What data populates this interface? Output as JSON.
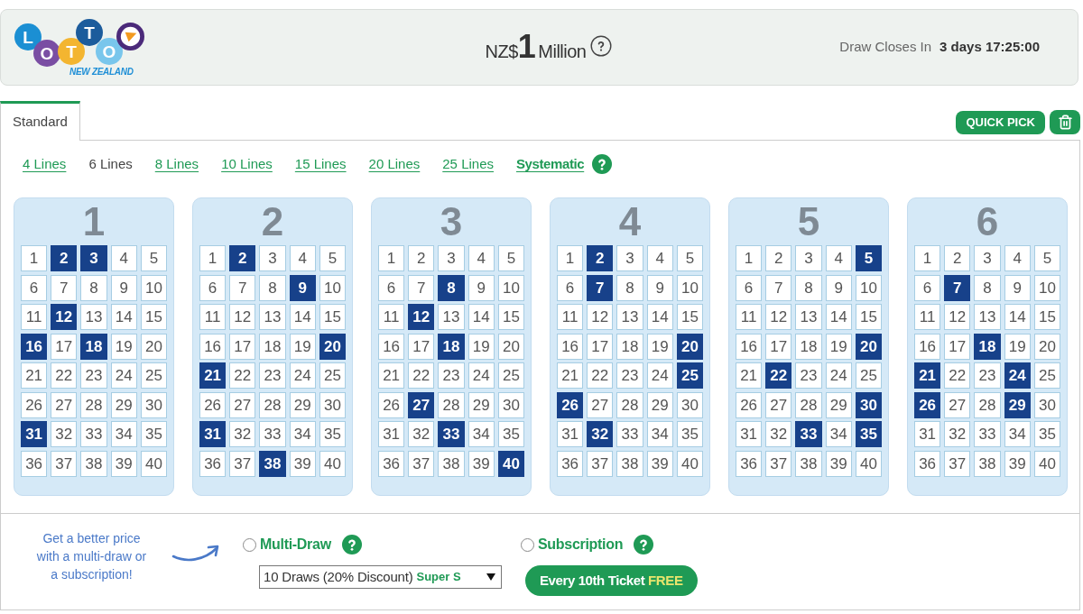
{
  "header": {
    "logo": {
      "balls": [
        {
          "letter": "L",
          "color": "#1b8fd3"
        },
        {
          "letter": "O",
          "color": "#7a4ea3"
        },
        {
          "letter": "T",
          "color": "#f3b530"
        },
        {
          "letter": "T",
          "color": "#1c5c9c"
        },
        {
          "letter": "O",
          "color": "#79c6ec"
        }
      ],
      "subtitle": "NEW ZEALAND"
    },
    "jackpot": {
      "currency": "NZ$",
      "amount": "1",
      "unit": "Million"
    },
    "draw_closes": {
      "label": "Draw Closes In",
      "value": "3 days 17:25:00"
    }
  },
  "tabs": [
    {
      "label": "Standard",
      "selected": true
    }
  ],
  "actions": {
    "quick_pick": "QUICK PICK"
  },
  "line_options": [
    {
      "label": "4 Lines",
      "selected": false,
      "kind": "link"
    },
    {
      "label": "6 Lines",
      "selected": true,
      "kind": "link"
    },
    {
      "label": "8 Lines",
      "selected": false,
      "kind": "link"
    },
    {
      "label": "10 Lines",
      "selected": false,
      "kind": "link"
    },
    {
      "label": "15 Lines",
      "selected": false,
      "kind": "link"
    },
    {
      "label": "20 Lines",
      "selected": false,
      "kind": "link"
    },
    {
      "label": "25 Lines",
      "selected": false,
      "kind": "link"
    },
    {
      "label": "Systematic",
      "selected": false,
      "kind": "systematic"
    }
  ],
  "panels": [
    {
      "number": "1",
      "cells": [
        {
          "n": "1",
          "selected": false
        },
        {
          "n": "2",
          "selected": true
        },
        {
          "n": "3",
          "selected": true
        },
        {
          "n": "4",
          "selected": false
        },
        {
          "n": "5",
          "selected": false
        },
        {
          "n": "6",
          "selected": false
        },
        {
          "n": "7",
          "selected": false
        },
        {
          "n": "8",
          "selected": false
        },
        {
          "n": "9",
          "selected": false
        },
        {
          "n": "10",
          "selected": false
        },
        {
          "n": "11",
          "selected": false
        },
        {
          "n": "12",
          "selected": true
        },
        {
          "n": "13",
          "selected": false
        },
        {
          "n": "14",
          "selected": false
        },
        {
          "n": "15",
          "selected": false
        },
        {
          "n": "16",
          "selected": true
        },
        {
          "n": "17",
          "selected": false
        },
        {
          "n": "18",
          "selected": true
        },
        {
          "n": "19",
          "selected": false
        },
        {
          "n": "20",
          "selected": false
        },
        {
          "n": "21",
          "selected": false
        },
        {
          "n": "22",
          "selected": false
        },
        {
          "n": "23",
          "selected": false
        },
        {
          "n": "24",
          "selected": false
        },
        {
          "n": "25",
          "selected": false
        },
        {
          "n": "26",
          "selected": false
        },
        {
          "n": "27",
          "selected": false
        },
        {
          "n": "28",
          "selected": false
        },
        {
          "n": "29",
          "selected": false
        },
        {
          "n": "30",
          "selected": false
        },
        {
          "n": "31",
          "selected": true
        },
        {
          "n": "32",
          "selected": false
        },
        {
          "n": "33",
          "selected": false
        },
        {
          "n": "34",
          "selected": false
        },
        {
          "n": "35",
          "selected": false
        },
        {
          "n": "36",
          "selected": false
        },
        {
          "n": "37",
          "selected": false
        },
        {
          "n": "38",
          "selected": false
        },
        {
          "n": "39",
          "selected": false
        },
        {
          "n": "40",
          "selected": false
        }
      ]
    },
    {
      "number": "2",
      "cells": [
        {
          "n": "1",
          "selected": false
        },
        {
          "n": "2",
          "selected": true
        },
        {
          "n": "3",
          "selected": false
        },
        {
          "n": "4",
          "selected": false
        },
        {
          "n": "5",
          "selected": false
        },
        {
          "n": "6",
          "selected": false
        },
        {
          "n": "7",
          "selected": false
        },
        {
          "n": "8",
          "selected": false
        },
        {
          "n": "9",
          "selected": true
        },
        {
          "n": "10",
          "selected": false
        },
        {
          "n": "11",
          "selected": false
        },
        {
          "n": "12",
          "selected": false
        },
        {
          "n": "13",
          "selected": false
        },
        {
          "n": "14",
          "selected": false
        },
        {
          "n": "15",
          "selected": false
        },
        {
          "n": "16",
          "selected": false
        },
        {
          "n": "17",
          "selected": false
        },
        {
          "n": "18",
          "selected": false
        },
        {
          "n": "19",
          "selected": false
        },
        {
          "n": "20",
          "selected": true
        },
        {
          "n": "21",
          "selected": true
        },
        {
          "n": "22",
          "selected": false
        },
        {
          "n": "23",
          "selected": false
        },
        {
          "n": "24",
          "selected": false
        },
        {
          "n": "25",
          "selected": false
        },
        {
          "n": "26",
          "selected": false
        },
        {
          "n": "27",
          "selected": false
        },
        {
          "n": "28",
          "selected": false
        },
        {
          "n": "29",
          "selected": false
        },
        {
          "n": "30",
          "selected": false
        },
        {
          "n": "31",
          "selected": true
        },
        {
          "n": "32",
          "selected": false
        },
        {
          "n": "33",
          "selected": false
        },
        {
          "n": "34",
          "selected": false
        },
        {
          "n": "35",
          "selected": false
        },
        {
          "n": "36",
          "selected": false
        },
        {
          "n": "37",
          "selected": false
        },
        {
          "n": "38",
          "selected": true
        },
        {
          "n": "39",
          "selected": false
        },
        {
          "n": "40",
          "selected": false
        }
      ]
    },
    {
      "number": "3",
      "cells": [
        {
          "n": "1",
          "selected": false
        },
        {
          "n": "2",
          "selected": false
        },
        {
          "n": "3",
          "selected": false
        },
        {
          "n": "4",
          "selected": false
        },
        {
          "n": "5",
          "selected": false
        },
        {
          "n": "6",
          "selected": false
        },
        {
          "n": "7",
          "selected": false
        },
        {
          "n": "8",
          "selected": true
        },
        {
          "n": "9",
          "selected": false
        },
        {
          "n": "10",
          "selected": false
        },
        {
          "n": "11",
          "selected": false
        },
        {
          "n": "12",
          "selected": true
        },
        {
          "n": "13",
          "selected": false
        },
        {
          "n": "14",
          "selected": false
        },
        {
          "n": "15",
          "selected": false
        },
        {
          "n": "16",
          "selected": false
        },
        {
          "n": "17",
          "selected": false
        },
        {
          "n": "18",
          "selected": true
        },
        {
          "n": "19",
          "selected": false
        },
        {
          "n": "20",
          "selected": false
        },
        {
          "n": "21",
          "selected": false
        },
        {
          "n": "22",
          "selected": false
        },
        {
          "n": "23",
          "selected": false
        },
        {
          "n": "24",
          "selected": false
        },
        {
          "n": "25",
          "selected": false
        },
        {
          "n": "26",
          "selected": false
        },
        {
          "n": "27",
          "selected": true
        },
        {
          "n": "28",
          "selected": false
        },
        {
          "n": "29",
          "selected": false
        },
        {
          "n": "30",
          "selected": false
        },
        {
          "n": "31",
          "selected": false
        },
        {
          "n": "32",
          "selected": false
        },
        {
          "n": "33",
          "selected": true
        },
        {
          "n": "34",
          "selected": false
        },
        {
          "n": "35",
          "selected": false
        },
        {
          "n": "36",
          "selected": false
        },
        {
          "n": "37",
          "selected": false
        },
        {
          "n": "38",
          "selected": false
        },
        {
          "n": "39",
          "selected": false
        },
        {
          "n": "40",
          "selected": true
        }
      ]
    },
    {
      "number": "4",
      "cells": [
        {
          "n": "1",
          "selected": false
        },
        {
          "n": "2",
          "selected": true
        },
        {
          "n": "3",
          "selected": false
        },
        {
          "n": "4",
          "selected": false
        },
        {
          "n": "5",
          "selected": false
        },
        {
          "n": "6",
          "selected": false
        },
        {
          "n": "7",
          "selected": true
        },
        {
          "n": "8",
          "selected": false
        },
        {
          "n": "9",
          "selected": false
        },
        {
          "n": "10",
          "selected": false
        },
        {
          "n": "11",
          "selected": false
        },
        {
          "n": "12",
          "selected": false
        },
        {
          "n": "13",
          "selected": false
        },
        {
          "n": "14",
          "selected": false
        },
        {
          "n": "15",
          "selected": false
        },
        {
          "n": "16",
          "selected": false
        },
        {
          "n": "17",
          "selected": false
        },
        {
          "n": "18",
          "selected": false
        },
        {
          "n": "19",
          "selected": false
        },
        {
          "n": "20",
          "selected": true
        },
        {
          "n": "21",
          "selected": false
        },
        {
          "n": "22",
          "selected": false
        },
        {
          "n": "23",
          "selected": false
        },
        {
          "n": "24",
          "selected": false
        },
        {
          "n": "25",
          "selected": true
        },
        {
          "n": "26",
          "selected": true
        },
        {
          "n": "27",
          "selected": false
        },
        {
          "n": "28",
          "selected": false
        },
        {
          "n": "29",
          "selected": false
        },
        {
          "n": "30",
          "selected": false
        },
        {
          "n": "31",
          "selected": false
        },
        {
          "n": "32",
          "selected": true
        },
        {
          "n": "33",
          "selected": false
        },
        {
          "n": "34",
          "selected": false
        },
        {
          "n": "35",
          "selected": false
        },
        {
          "n": "36",
          "selected": false
        },
        {
          "n": "37",
          "selected": false
        },
        {
          "n": "38",
          "selected": false
        },
        {
          "n": "39",
          "selected": false
        },
        {
          "n": "40",
          "selected": false
        }
      ]
    },
    {
      "number": "5",
      "cells": [
        {
          "n": "1",
          "selected": false
        },
        {
          "n": "2",
          "selected": false
        },
        {
          "n": "3",
          "selected": false
        },
        {
          "n": "4",
          "selected": false
        },
        {
          "n": "5",
          "selected": true
        },
        {
          "n": "6",
          "selected": false
        },
        {
          "n": "7",
          "selected": false
        },
        {
          "n": "8",
          "selected": false
        },
        {
          "n": "9",
          "selected": false
        },
        {
          "n": "10",
          "selected": false
        },
        {
          "n": "11",
          "selected": false
        },
        {
          "n": "12",
          "selected": false
        },
        {
          "n": "13",
          "selected": false
        },
        {
          "n": "14",
          "selected": false
        },
        {
          "n": "15",
          "selected": false
        },
        {
          "n": "16",
          "selected": false
        },
        {
          "n": "17",
          "selected": false
        },
        {
          "n": "18",
          "selected": false
        },
        {
          "n": "19",
          "selected": false
        },
        {
          "n": "20",
          "selected": true
        },
        {
          "n": "21",
          "selected": false
        },
        {
          "n": "22",
          "selected": true
        },
        {
          "n": "23",
          "selected": false
        },
        {
          "n": "24",
          "selected": false
        },
        {
          "n": "25",
          "selected": false
        },
        {
          "n": "26",
          "selected": false
        },
        {
          "n": "27",
          "selected": false
        },
        {
          "n": "28",
          "selected": false
        },
        {
          "n": "29",
          "selected": false
        },
        {
          "n": "30",
          "selected": true
        },
        {
          "n": "31",
          "selected": false
        },
        {
          "n": "32",
          "selected": false
        },
        {
          "n": "33",
          "selected": true
        },
        {
          "n": "34",
          "selected": false
        },
        {
          "n": "35",
          "selected": true
        },
        {
          "n": "36",
          "selected": false
        },
        {
          "n": "37",
          "selected": false
        },
        {
          "n": "38",
          "selected": false
        },
        {
          "n": "39",
          "selected": false
        },
        {
          "n": "40",
          "selected": false
        }
      ]
    },
    {
      "number": "6",
      "cells": [
        {
          "n": "1",
          "selected": false
        },
        {
          "n": "2",
          "selected": false
        },
        {
          "n": "3",
          "selected": false
        },
        {
          "n": "4",
          "selected": false
        },
        {
          "n": "5",
          "selected": false
        },
        {
          "n": "6",
          "selected": false
        },
        {
          "n": "7",
          "selected": true
        },
        {
          "n": "8",
          "selected": false
        },
        {
          "n": "9",
          "selected": false
        },
        {
          "n": "10",
          "selected": false
        },
        {
          "n": "11",
          "selected": false
        },
        {
          "n": "12",
          "selected": false
        },
        {
          "n": "13",
          "selected": false
        },
        {
          "n": "14",
          "selected": false
        },
        {
          "n": "15",
          "selected": false
        },
        {
          "n": "16",
          "selected": false
        },
        {
          "n": "17",
          "selected": false
        },
        {
          "n": "18",
          "selected": true
        },
        {
          "n": "19",
          "selected": false
        },
        {
          "n": "20",
          "selected": false
        },
        {
          "n": "21",
          "selected": true
        },
        {
          "n": "22",
          "selected": false
        },
        {
          "n": "23",
          "selected": false
        },
        {
          "n": "24",
          "selected": true
        },
        {
          "n": "25",
          "selected": false
        },
        {
          "n": "26",
          "selected": true
        },
        {
          "n": "27",
          "selected": false
        },
        {
          "n": "28",
          "selected": false
        },
        {
          "n": "29",
          "selected": true
        },
        {
          "n": "30",
          "selected": false
        },
        {
          "n": "31",
          "selected": false
        },
        {
          "n": "32",
          "selected": false
        },
        {
          "n": "33",
          "selected": false
        },
        {
          "n": "34",
          "selected": false
        },
        {
          "n": "35",
          "selected": false
        },
        {
          "n": "36",
          "selected": false
        },
        {
          "n": "37",
          "selected": false
        },
        {
          "n": "38",
          "selected": false
        },
        {
          "n": "39",
          "selected": false
        },
        {
          "n": "40",
          "selected": false
        }
      ]
    }
  ],
  "promo": {
    "note": "Get a better price with a multi-draw or a subscription!",
    "multi_draw": {
      "label": "Multi-Draw",
      "checked": false,
      "select": {
        "value": "10 Draws (20% Discount)",
        "tag": "Super S"
      }
    },
    "subscription": {
      "label": "Subscription",
      "checked": false,
      "badge": {
        "text": "Every 10th Ticket",
        "highlight": "FREE"
      }
    }
  }
}
